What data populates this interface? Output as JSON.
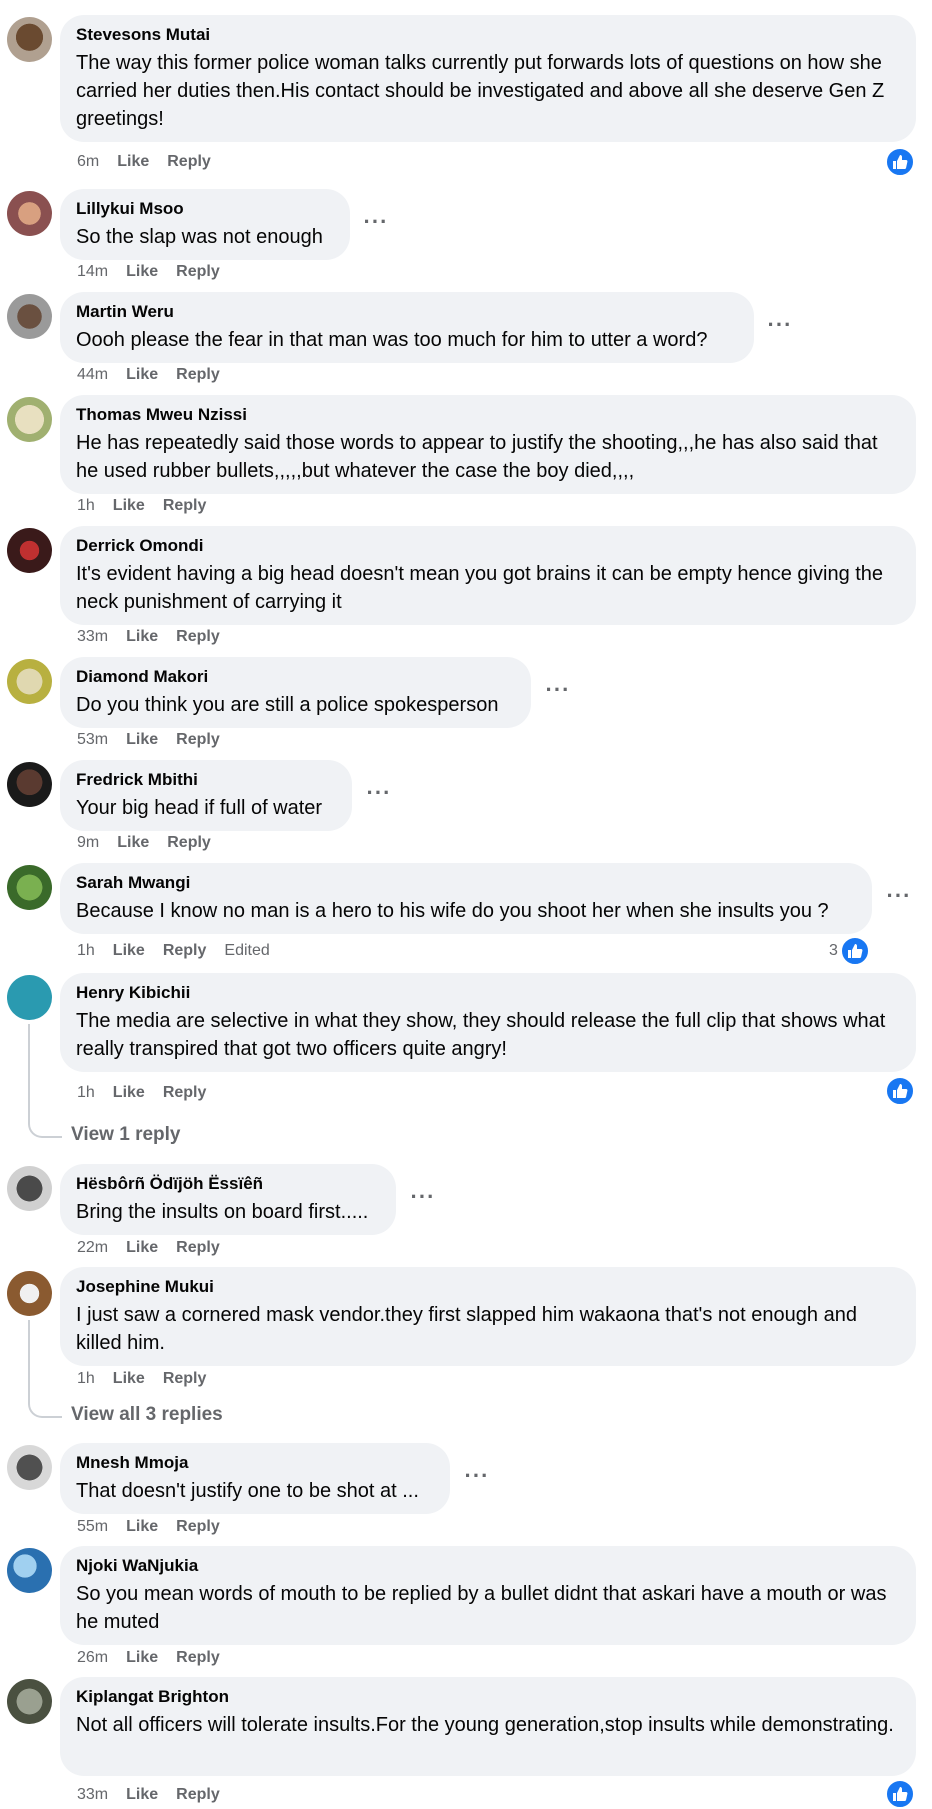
{
  "comments": [
    {
      "author": "Stevesons Mutai",
      "text": "The way this former police woman talks currently put forwards lots of questions on how she carried her duties then.His contact should be investigated and above all she deserve Gen Z greetings!",
      "time": "6m",
      "like": "Like",
      "reply": "Reply",
      "reactions": "like-icon"
    },
    {
      "author": "Lillykui Msoo",
      "text": "So the slap was not enough",
      "time": "14m",
      "like": "Like",
      "reply": "Reply"
    },
    {
      "author": "Martin Weru",
      "text": "Oooh please the fear in that man was too much for him to utter a word?",
      "time": "44m",
      "like": "Like",
      "reply": "Reply"
    },
    {
      "author": "Thomas Mweu Nzissi",
      "text": "He has repeatedly said those words to appear to justify the shooting,,,he has also said that he used rubber bullets,,,,,but whatever the case the boy died,,,,",
      "time": "1h",
      "like": "Like",
      "reply": "Reply"
    },
    {
      "author": "Derrick Omondi",
      "text": "It's evident having a big head doesn't mean you got brains it can be empty hence giving the neck punishment of carrying it",
      "time": "33m",
      "like": "Like",
      "reply": "Reply"
    },
    {
      "author": "Diamond Makori",
      "text": "Do you think you are still a police spokesperson",
      "time": "53m",
      "like": "Like",
      "reply": "Reply"
    },
    {
      "author": "Fredrick Mbithi",
      "text": "Your big head if full of water",
      "time": "9m",
      "like": "Like",
      "reply": "Reply"
    },
    {
      "author": "Sarah Mwangi",
      "text": "Because I know no man is a hero to his wife do you shoot her when she insults you ?",
      "time": "1h",
      "like": "Like",
      "reply": "Reply",
      "edited": "Edited",
      "reaction_count": "3"
    },
    {
      "author": "Henry Kibichii",
      "text": "The media are selective in what they show, they should release the full clip that shows what really transpired that got two officers quite angry!",
      "time": "1h",
      "like": "Like",
      "reply": "Reply",
      "view_replies": "View 1 reply"
    },
    {
      "author": "Hësbôrñ Ödïjöh Ëssïêñ",
      "text": "Bring the insults on board first.....",
      "time": "22m",
      "like": "Like",
      "reply": "Reply"
    },
    {
      "author": "Josephine Mukui",
      "text": "I just saw a cornered mask vendor.they first slapped him wakaona that's not enough and killed him.",
      "time": "1h",
      "like": "Like",
      "reply": "Reply",
      "view_replies": "View all 3 replies"
    },
    {
      "author": "Mnesh Mmoja",
      "text": "That doesn't justify one to be shot at ...",
      "time": "55m",
      "like": "Like",
      "reply": "Reply"
    },
    {
      "author": "Njoki WaNjukia",
      "text": "So you mean words of mouth to be replied by a bullet didnt that askari have a mouth or was he muted",
      "time": "26m",
      "like": "Like",
      "reply": "Reply"
    },
    {
      "author": "Kiplangat Brighton",
      "text": "Not all officers will tolerate insults.For the young generation,stop insults while demonstrating.",
      "time": "33m",
      "like": "Like",
      "reply": "Reply"
    }
  ],
  "avatar_colors": [
    "#8a6a50",
    "#c89070",
    "#6a5a50",
    "#a0b070",
    "#6a2a2a",
    "#c8c060",
    "#3a3a3a",
    "#5a9040",
    "#2a9ab0",
    "#888888",
    "#c07050",
    "#b0b0b0",
    "#3a80c0",
    "#7a8070"
  ],
  "accent": "#1877f2"
}
